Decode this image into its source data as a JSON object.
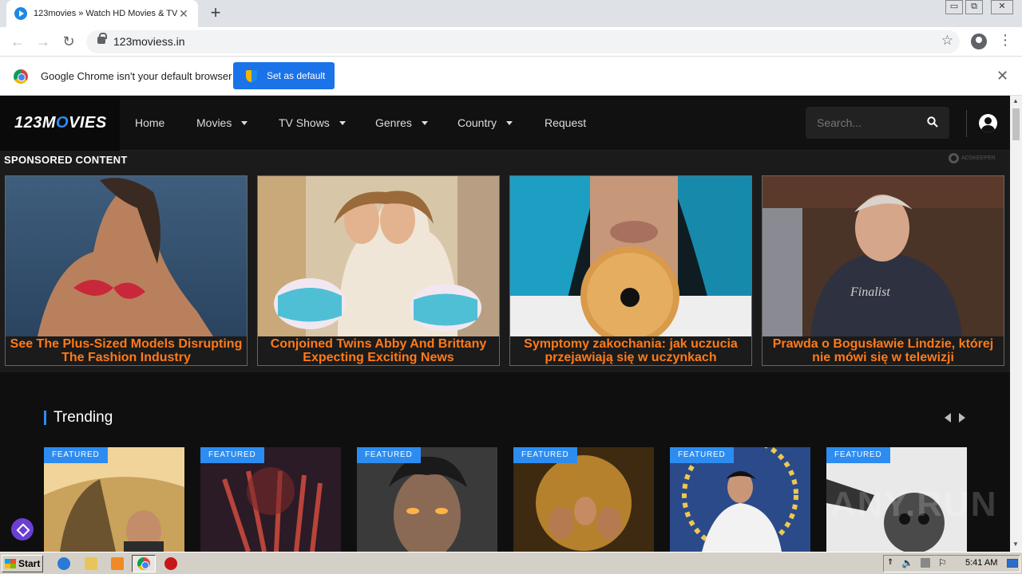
{
  "browser": {
    "tab_title": "123movies » Watch HD Movies & TV",
    "tab_close": "✕",
    "new_tab": "+",
    "url": "123moviess.in",
    "window_controls": [
      "▭",
      "⧉",
      "✕"
    ]
  },
  "infobar": {
    "message": "Google Chrome isn't your default browser",
    "button": "Set as default",
    "close": "✕"
  },
  "site": {
    "logo": {
      "left": "123M",
      "accent": "O",
      "right": "VIES"
    },
    "nav": [
      {
        "label": "Home",
        "dropdown": false
      },
      {
        "label": "Movies",
        "dropdown": true
      },
      {
        "label": "TV Shows",
        "dropdown": true
      },
      {
        "label": "Genres",
        "dropdown": true
      },
      {
        "label": "Country",
        "dropdown": true
      },
      {
        "label": "Request",
        "dropdown": false
      }
    ],
    "search_placeholder": "Search...",
    "accent_color": "#2d8cf0",
    "sponsored": {
      "title": "SPONSORED CONTENT",
      "network": "ADSKEEPER",
      "ads": [
        {
          "caption": "See The Plus-Sized Models Disrupting The Fashion Industry"
        },
        {
          "caption": "Conjoined Twins Abby And Brittany Expecting Exciting News"
        },
        {
          "caption": "Symptomy zakochania: jak uczucia przejawiają się w uczynkach"
        },
        {
          "caption": "Prawda o Bogusławie Lindzie, której nie mówi się w telewizji"
        }
      ],
      "caption_color": "#ff7a1a"
    },
    "trending": {
      "title": "Trending",
      "badge": "FEATURED",
      "poster_count_label": "FEATURED"
    },
    "watermark": "ANY.RUN"
  },
  "taskbar": {
    "start": "Start",
    "clock": "5:41 AM"
  }
}
